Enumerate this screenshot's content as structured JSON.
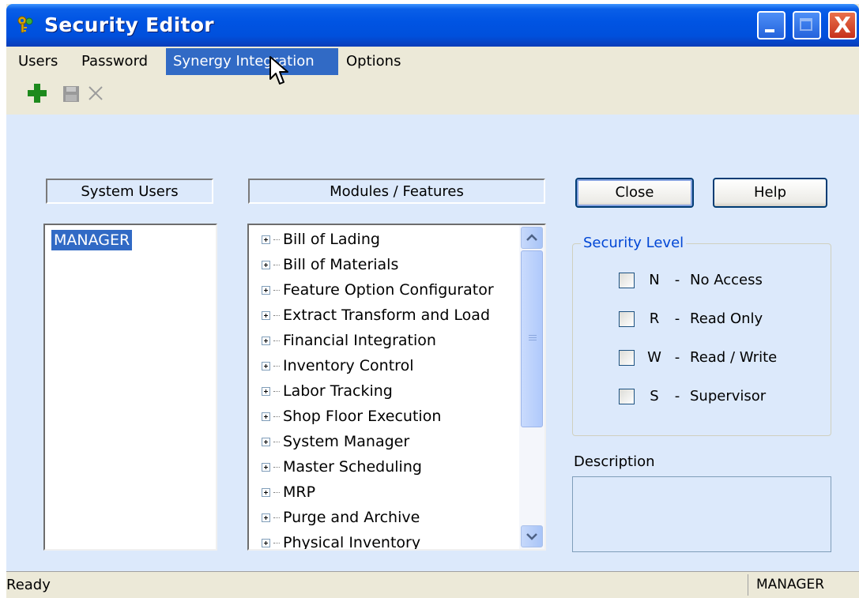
{
  "window": {
    "title": "Security Editor",
    "icons": {
      "app": "keys-icon",
      "minimize": "minimize-icon",
      "maximize": "maximize-icon",
      "close": "close-icon"
    },
    "titlebar_color": "#0054e3",
    "close_glyph": "X"
  },
  "menu": {
    "items": [
      {
        "label": "Users"
      },
      {
        "label": "Password"
      },
      {
        "label": "Synergy Integration"
      },
      {
        "label": "Options"
      }
    ],
    "active": "Synergy Integration"
  },
  "toolbar": {
    "icons": [
      "add-icon",
      "save-icon",
      "delete-icon"
    ]
  },
  "users_panel": {
    "header": "System Users",
    "users": [
      "MANAGER"
    ],
    "selected": "MANAGER"
  },
  "modules_panel": {
    "header": "Modules / Features",
    "items": [
      "Bill of Lading",
      "Bill of Materials",
      "Feature Option Configurator",
      "Extract Transform and Load",
      "Financial Integration",
      "Inventory Control",
      "Labor Tracking",
      "Shop Floor Execution",
      "System Manager",
      "Master Scheduling",
      "MRP",
      "Purge and Archive",
      "Physical Inventory"
    ]
  },
  "buttons": {
    "close": "Close",
    "help": "Help"
  },
  "security_level": {
    "legend": "Security Level",
    "options": [
      {
        "code": "N",
        "dash": "-",
        "label": "No Access",
        "checked": false
      },
      {
        "code": "R",
        "dash": "-",
        "label": "Read Only",
        "checked": false
      },
      {
        "code": "W",
        "dash": "-",
        "label": "Read / Write",
        "checked": false
      },
      {
        "code": "S",
        "dash": "-",
        "label": "Supervisor",
        "checked": false
      }
    ],
    "legend_color": "#0046d5"
  },
  "description": {
    "label": "Description",
    "value": ""
  },
  "status": {
    "text": "Ready",
    "user": "MANAGER"
  }
}
